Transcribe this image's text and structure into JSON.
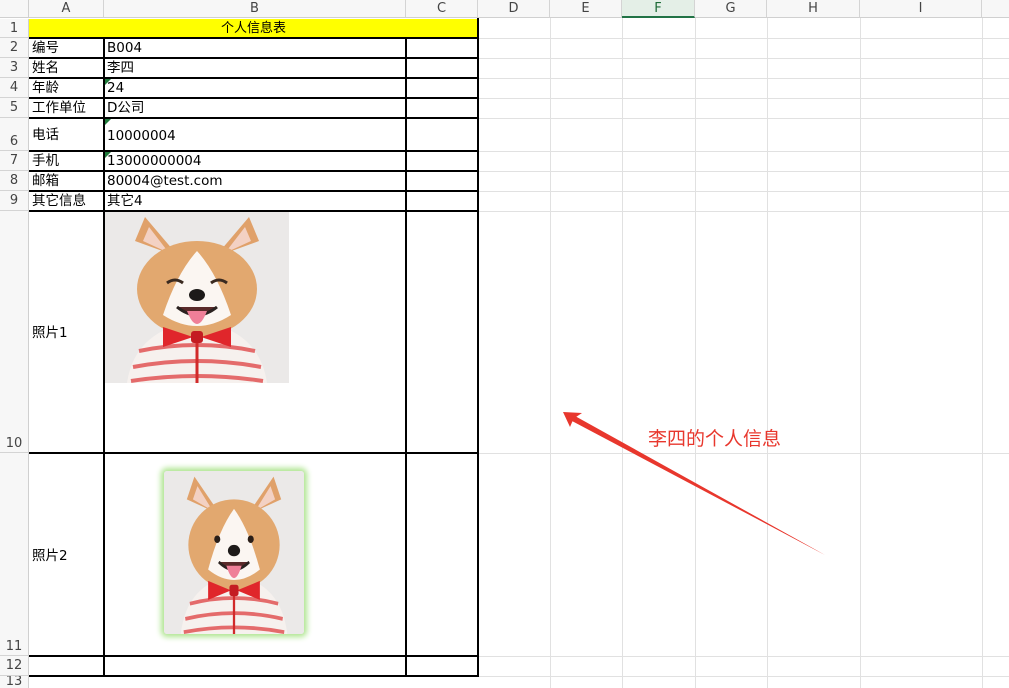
{
  "columns": [
    "A",
    "B",
    "C",
    "D",
    "E",
    "F",
    "G",
    "H",
    "I"
  ],
  "rows": [
    "1",
    "2",
    "3",
    "4",
    "5",
    "6",
    "7",
    "8",
    "9",
    "10",
    "11",
    "12",
    "13"
  ],
  "table": {
    "title": "个人信息表",
    "labels": [
      "编号",
      "姓名",
      "年龄",
      "工作单位",
      "电话",
      "手机",
      "邮箱",
      "其它信息",
      "照片1",
      "照片2"
    ],
    "values": [
      "B004",
      "李四",
      "24",
      "D公司",
      "10000004",
      "13000000004",
      "80004@test.com",
      "其它4"
    ]
  },
  "photos": [
    {
      "icon": "dog-photo-icon"
    },
    {
      "icon": "dog-photo-icon"
    }
  ],
  "annotation": {
    "text": "李四的个人信息",
    "color": "#e8372d",
    "arrow_icon": "red-arrow-icon"
  },
  "colors": {
    "title_fill": "#ffff00",
    "selected_column_accent": "#217346",
    "number_marker": "#1f7a3a"
  }
}
